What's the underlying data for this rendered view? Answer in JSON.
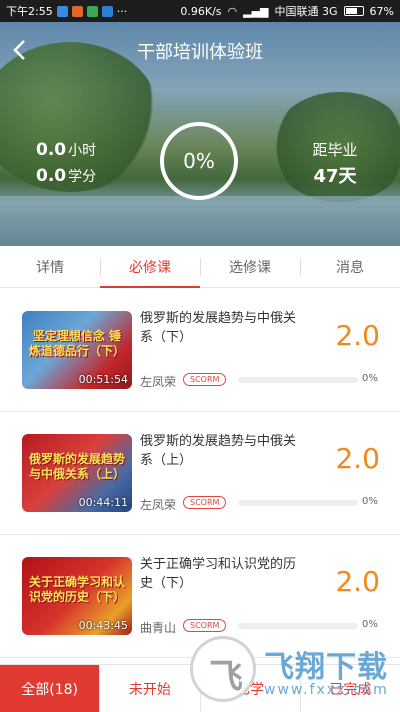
{
  "status_bar": {
    "time": "下午2:55",
    "speed": "0.96K/s",
    "carrier": "中国联通 3G",
    "battery": "67%",
    "battery_level": 0.67
  },
  "header": {
    "title": "干部培训体验班",
    "hours_value": "0.0",
    "hours_unit": "小时",
    "credits_value": "0.0",
    "credits_unit": "学分",
    "progress": "0%",
    "graduation_label": "距毕业",
    "graduation_days": "47天"
  },
  "tabs": [
    {
      "label": "详情"
    },
    {
      "label": "必修课",
      "active": true
    },
    {
      "label": "选修课"
    },
    {
      "label": "消息"
    }
  ],
  "courses": [
    {
      "title": "俄罗斯的发展趋势与中俄关系（下）",
      "score": "2.0",
      "teacher": "左凤荣",
      "badge": "SCORM",
      "progress": "0%",
      "duration": "00:51:54",
      "thumb_text": "坚定理想信念 锤炼道德品行（下）"
    },
    {
      "title": "俄罗斯的发展趋势与中俄关系（上）",
      "score": "2.0",
      "teacher": "左凤荣",
      "badge": "SCORM",
      "progress": "0%",
      "duration": "00:44:11",
      "thumb_text": "俄罗斯的发展趋势与中俄关系（上）"
    },
    {
      "title": "关于正确学习和认识党的历史（下）",
      "score": "2.0",
      "teacher": "曲青山",
      "badge": "SCORM",
      "progress": "0%",
      "duration": "00:43:45",
      "thumb_text": "关于正确学习和认识党的历史（下）"
    }
  ],
  "filters": [
    {
      "label": "全部(18)",
      "active": true
    },
    {
      "label": "未开始"
    },
    {
      "label": "已学"
    },
    {
      "label": "已完成"
    }
  ],
  "watermark": {
    "brand": "飞翔下载",
    "url": "www.fxxz.com"
  },
  "colors": {
    "accent": "#e03a33",
    "score": "#f08a1e"
  }
}
